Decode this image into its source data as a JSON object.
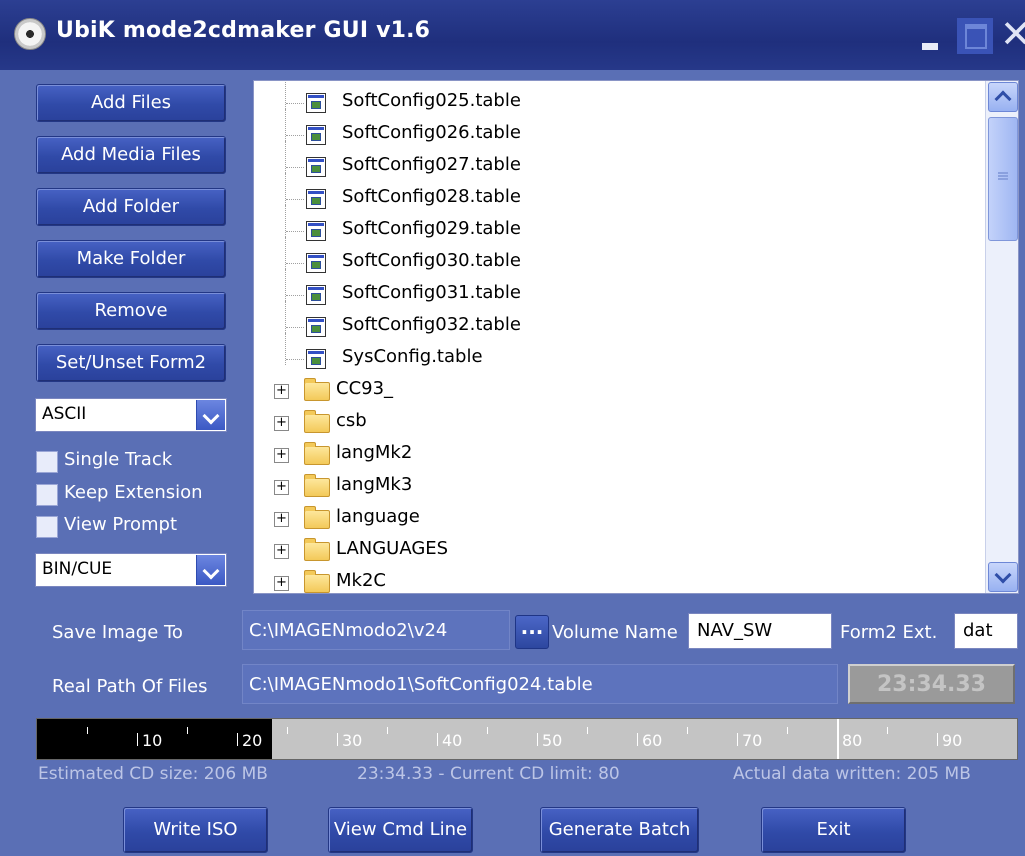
{
  "window": {
    "title": "UbiK mode2cdmaker GUI v1.6"
  },
  "left_panel": {
    "buttons": [
      "Add Files",
      "Add Media Files",
      "Add Folder",
      "Make Folder",
      "Remove",
      "Set/Unset Form2"
    ],
    "encoding_select": "ASCII",
    "checkboxes": [
      {
        "label": "Single Track",
        "checked": false
      },
      {
        "label": "Keep Extension",
        "checked": false
      },
      {
        "label": "View Prompt",
        "checked": false
      }
    ],
    "format_select": "BIN/CUE"
  },
  "tree": {
    "files": [
      "SoftConfig025.table",
      "SoftConfig026.table",
      "SoftConfig027.table",
      "SoftConfig028.table",
      "SoftConfig029.table",
      "SoftConfig030.table",
      "SoftConfig031.table",
      "SoftConfig032.table",
      "SysConfig.table"
    ],
    "folders": [
      "CC93_",
      "csb",
      "langMk2",
      "langMk3",
      "language",
      "LANGUAGES",
      "Mk2C"
    ]
  },
  "save_image": {
    "label": "Save Image To",
    "path": "C:\\IMAGENmodo2\\v24",
    "browse_label": "..."
  },
  "volume": {
    "label": "Volume Name",
    "value": "NAV_SW"
  },
  "form2": {
    "label": "Form2 Ext.",
    "value": "dat"
  },
  "real_path": {
    "label": "Real Path Of Files",
    "path": "C:\\IMAGENmodo1\\SoftConfig024.table"
  },
  "time_display": "23:34.33",
  "cd_progress": {
    "filled_minutes": 23.5,
    "max_minutes": 98,
    "limit_minutes": 80,
    "tick_labels": [
      "10",
      "20",
      "30",
      "40",
      "50",
      "60",
      "70",
      "80",
      "90"
    ]
  },
  "status": {
    "estimated": "Estimated CD size: 206 MB",
    "limit": "23:34.33 - Current CD limit: 80",
    "written": "Actual data written: 205 MB"
  },
  "bottom_buttons": {
    "write_iso": "Write ISO",
    "view_cmd": "View Cmd Line",
    "generate_batch": "Generate Batch",
    "exit": "Exit"
  }
}
